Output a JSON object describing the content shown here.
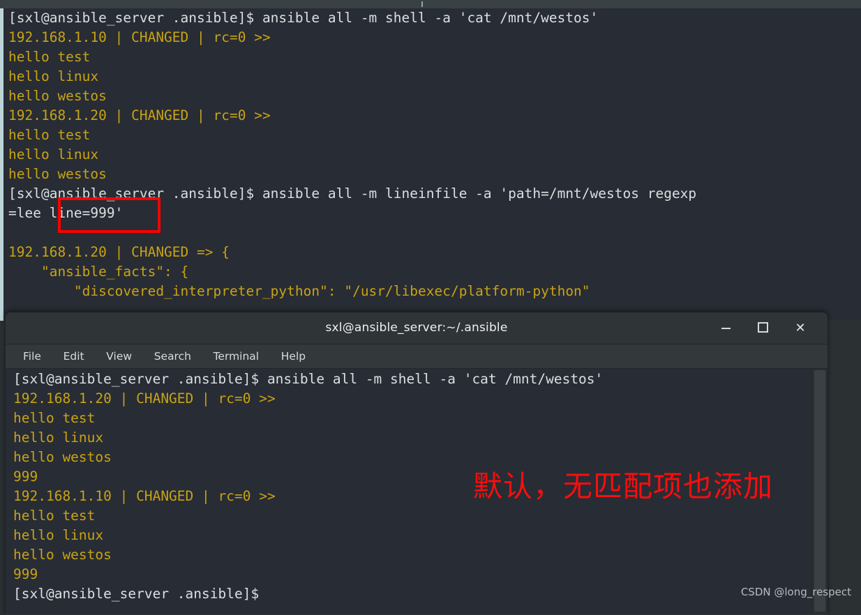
{
  "back_terminal": {
    "name": "background-terminal",
    "lines": [
      {
        "text": "[sxl@ansible_server .ansible]$ ansible all -m shell -a 'cat /mnt/westos'",
        "color": "white"
      },
      {
        "text": "192.168.1.10 | CHANGED | rc=0 >>",
        "color": "yellow"
      },
      {
        "text": "hello test",
        "color": "yellow"
      },
      {
        "text": "hello linux",
        "color": "yellow"
      },
      {
        "text": "hello westos",
        "color": "yellow"
      },
      {
        "text": "192.168.1.20 | CHANGED | rc=0 >>",
        "color": "yellow"
      },
      {
        "text": "hello test",
        "color": "yellow"
      },
      {
        "text": "hello linux",
        "color": "yellow"
      },
      {
        "text": "hello westos",
        "color": "yellow"
      },
      {
        "text": "[sxl@ansible_server .ansible]$ ansible all -m lineinfile -a 'path=/mnt/westos regexp",
        "color": "white"
      },
      {
        "text": "=lee line=999'",
        "color": "white"
      },
      {
        "text": "",
        "color": "white"
      },
      {
        "text": "192.168.1.20 | CHANGED => {",
        "color": "yellow"
      },
      {
        "text": "    \"ansible_facts\": {",
        "color": "yellow"
      },
      {
        "text": "        \"discovered_interpreter_python\": \"/usr/libexec/platform-python\"",
        "color": "yellow"
      }
    ]
  },
  "front_window": {
    "title": "sxl@ansible_server:~/.ansible",
    "controls": {
      "minimize": "minimize-button",
      "maximize": "maximize-button",
      "close": "✕"
    },
    "menu": [
      "File",
      "Edit",
      "View",
      "Search",
      "Terminal",
      "Help"
    ],
    "terminal_lines": [
      {
        "text": "[sxl@ansible_server .ansible]$ ansible all -m shell -a 'cat /mnt/westos'",
        "color": "white"
      },
      {
        "text": "192.168.1.20 | CHANGED | rc=0 >>",
        "color": "yellow"
      },
      {
        "text": "hello test",
        "color": "yellow"
      },
      {
        "text": "hello linux",
        "color": "yellow"
      },
      {
        "text": "hello westos",
        "color": "yellow"
      },
      {
        "text": "999",
        "color": "yellow"
      },
      {
        "text": "192.168.1.10 | CHANGED | rc=0 >>",
        "color": "yellow"
      },
      {
        "text": "hello test",
        "color": "yellow"
      },
      {
        "text": "hello linux",
        "color": "yellow"
      },
      {
        "text": "hello westos",
        "color": "yellow"
      },
      {
        "text": "999",
        "color": "yellow"
      },
      {
        "text": "[sxl@ansible_server .ansible]$",
        "color": "white"
      }
    ]
  },
  "annotations": {
    "highlight_box_label": "line=999'",
    "red_note": "默认，无匹配项也添加",
    "watermark": "CSDN @long_respect"
  },
  "colors": {
    "terminal_bg": "#282c34",
    "prompt_text": "#dcdfe2",
    "output_text": "#c8a415",
    "annotation_red": "#fb0d0d",
    "window_chrome": "#2f3437",
    "menubar": "#33383b"
  }
}
